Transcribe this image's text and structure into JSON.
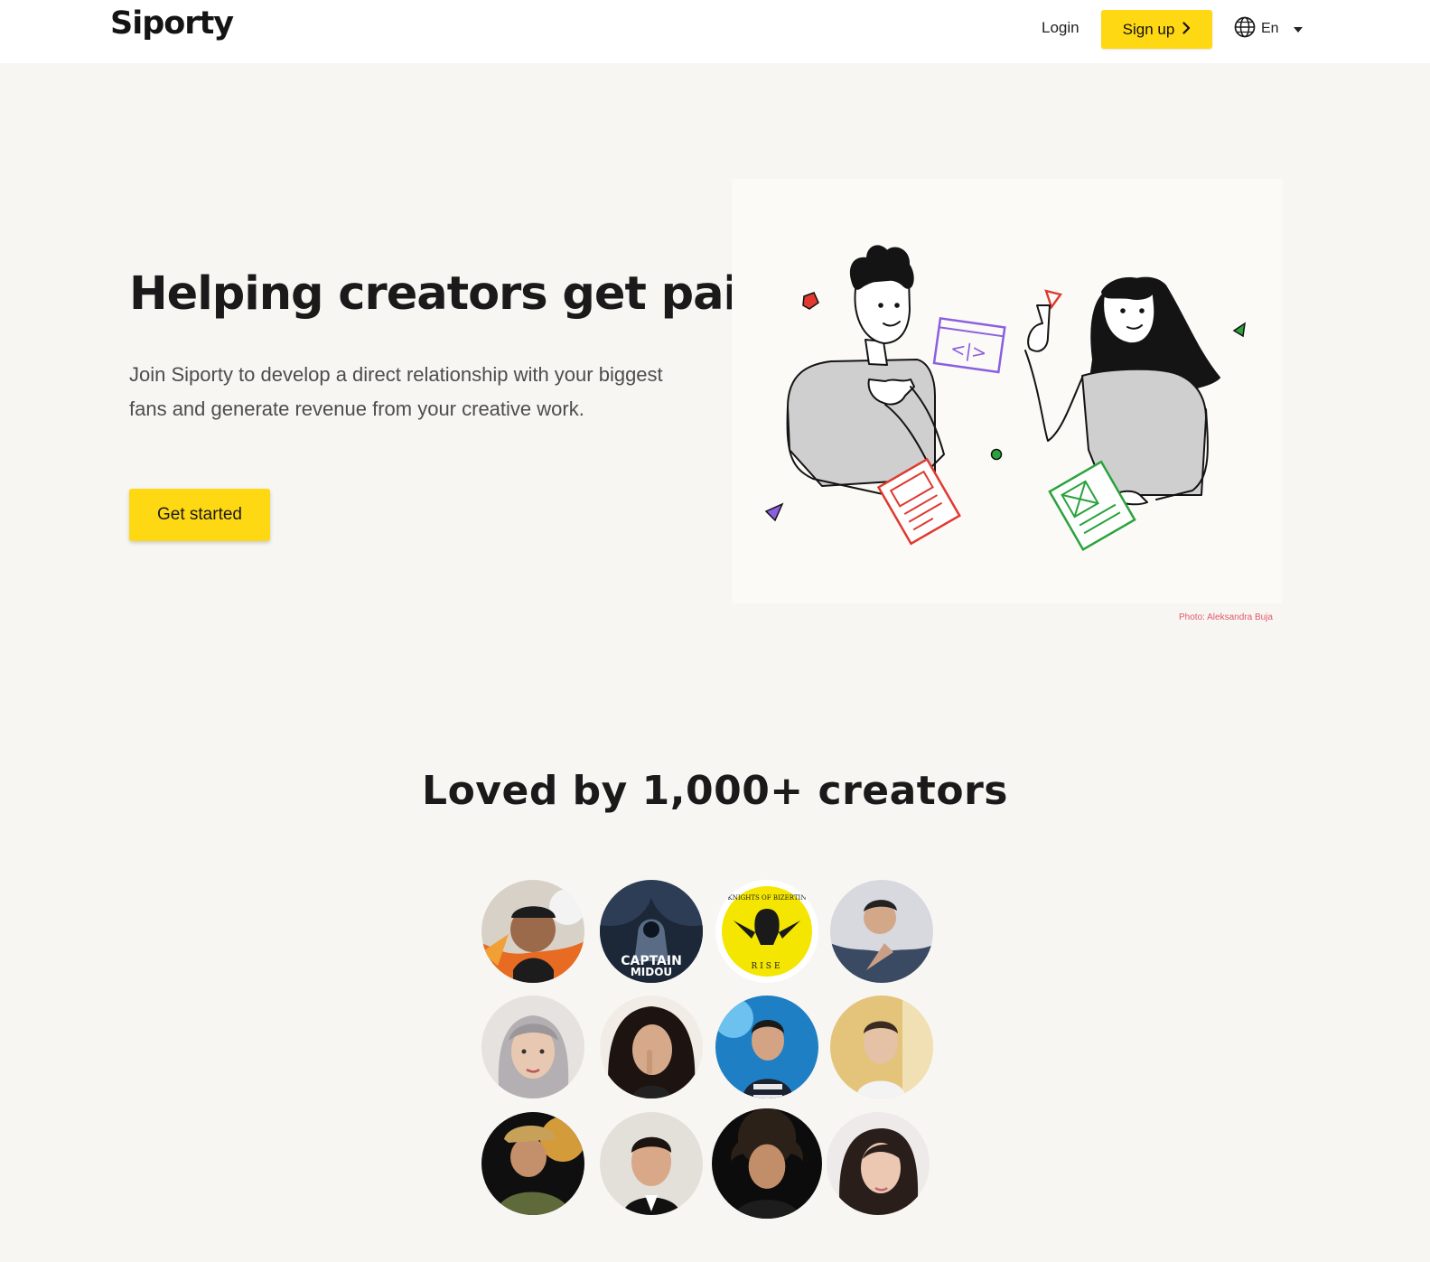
{
  "header": {
    "logo": "Siporty",
    "login_label": "Login",
    "signup_label": "Sign up",
    "language_label": "En",
    "icons": {
      "signup": "chevron-right-icon",
      "language": "globe-icon",
      "dropdown": "caret-down-icon"
    }
  },
  "hero": {
    "title": "Helping creators get paid",
    "description": "Join Siporty to develop a direct relationship with your biggest fans and generate revenue from your creative work.",
    "cta_label": "Get started",
    "photo_credit": "Photo: Aleksandra Buja"
  },
  "creators": {
    "title": "Loved by 1,000+ creators",
    "avatars": [
      {
        "badge_top": "",
        "badge_bottom": ""
      },
      {
        "badge_top": "CAPTAIN",
        "badge_bottom": "MIDOU"
      },
      {
        "badge_top": "KNIGHTS OF BIZERTIN",
        "badge_bottom": "RISE"
      },
      {
        "badge_top": "",
        "badge_bottom": ""
      },
      {
        "badge_top": "",
        "badge_bottom": ""
      },
      {
        "badge_top": "",
        "badge_bottom": ""
      },
      {
        "badge_top": "",
        "badge_bottom": ""
      },
      {
        "badge_top": "",
        "badge_bottom": ""
      },
      {
        "badge_top": "",
        "badge_bottom": ""
      },
      {
        "badge_top": "",
        "badge_bottom": ""
      },
      {
        "badge_top": "",
        "badge_bottom": ""
      },
      {
        "badge_top": "",
        "badge_bottom": ""
      }
    ]
  },
  "colors": {
    "accent": "#ffd814",
    "page_background": "#f8f6f2",
    "header_background": "#ffffff",
    "credit": "#e05a6a"
  }
}
